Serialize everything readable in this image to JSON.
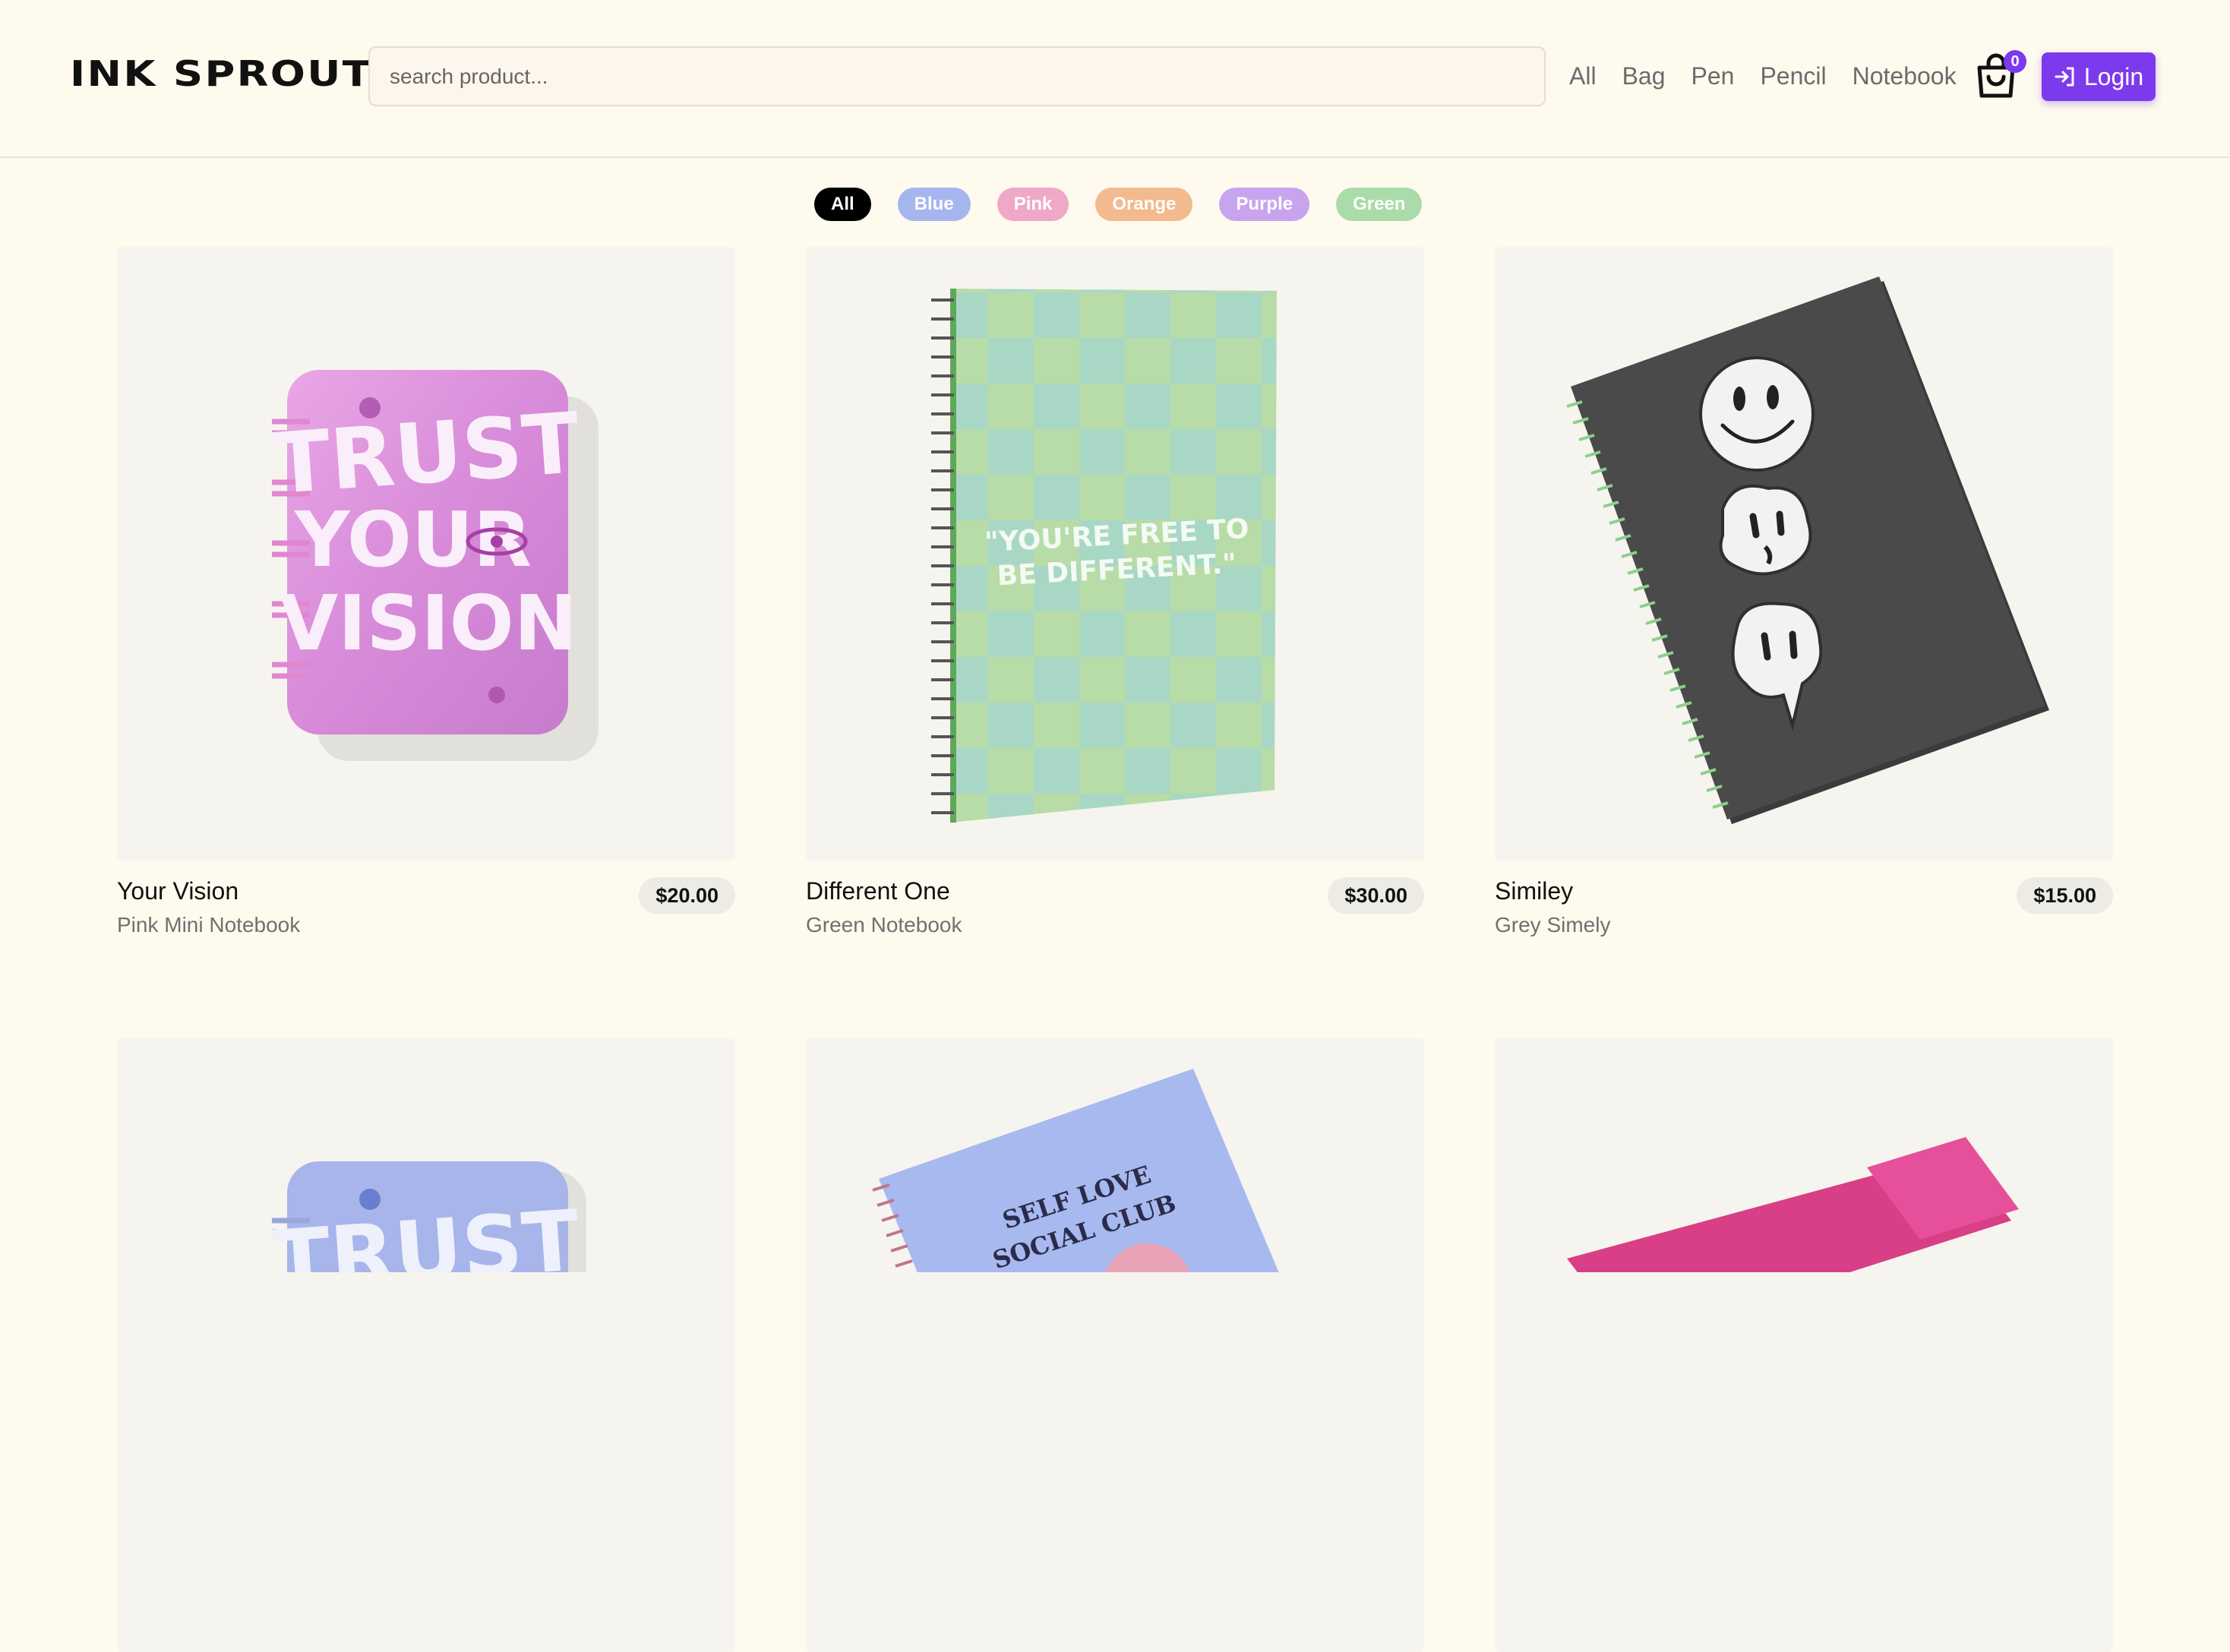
{
  "header": {
    "logo": "INK SPROUT",
    "search_placeholder": "search product...",
    "nav": [
      "All",
      "Bag",
      "Pen",
      "Pencil",
      "Notebook"
    ],
    "cart_count": "0",
    "login_label": "Login"
  },
  "filters": [
    {
      "label": "All",
      "color": "#000000"
    },
    {
      "label": "Blue",
      "color": "#a5b6ef"
    },
    {
      "label": "Pink",
      "color": "#f0a8c8"
    },
    {
      "label": "Orange",
      "color": "#f3b98f"
    },
    {
      "label": "Purple",
      "color": "#c9a4ee"
    },
    {
      "label": "Green",
      "color": "#a9dca9"
    }
  ],
  "products": [
    {
      "name": "Your Vision",
      "subtitle": "Pink Mini Notebook",
      "price": "$20.00",
      "cover_text": "TRUST YOUR VISION"
    },
    {
      "name": "Different One",
      "subtitle": "Green Notebook",
      "price": "$30.00",
      "cover_text": "\"YOU'RE FREE TO BE DIFFERENT.\""
    },
    {
      "name": "Similey",
      "subtitle": "Grey Simely",
      "price": "$15.00",
      "cover_text": ""
    },
    {
      "name": "",
      "subtitle": "",
      "price": "",
      "cover_text": "TRUST"
    },
    {
      "name": "",
      "subtitle": "",
      "price": "",
      "cover_text": "SELF LOVE SOCIAL CLUB"
    },
    {
      "name": "",
      "subtitle": "",
      "price": "",
      "cover_text": ""
    }
  ]
}
